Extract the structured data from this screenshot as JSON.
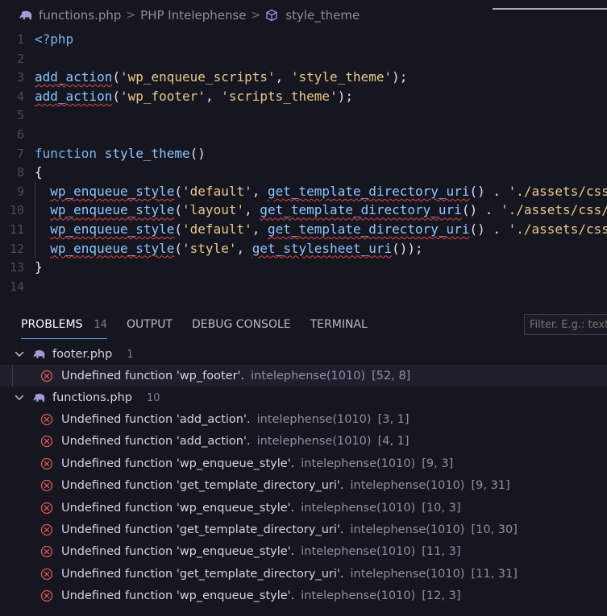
{
  "breadcrumb": {
    "file": "functions.php",
    "section": "PHP Intelephense",
    "symbol": "style_theme"
  },
  "editor": {
    "lines": [
      {
        "n": "1",
        "tokens": [
          {
            "t": "<?php",
            "c": "kw"
          }
        ]
      },
      {
        "n": "2",
        "tokens": []
      },
      {
        "n": "3",
        "tokens": [
          {
            "t": "add_action",
            "c": "fn",
            "sq": true
          },
          {
            "t": "(",
            "c": "punc"
          },
          {
            "t": "'wp_enqueue_scripts'",
            "c": "str"
          },
          {
            "t": ", ",
            "c": "punc"
          },
          {
            "t": "'style_theme'",
            "c": "str"
          },
          {
            "t": ");",
            "c": "punc"
          }
        ]
      },
      {
        "n": "4",
        "tokens": [
          {
            "t": "add_action",
            "c": "fn",
            "sq": true
          },
          {
            "t": "(",
            "c": "punc"
          },
          {
            "t": "'wp_footer'",
            "c": "str"
          },
          {
            "t": ", ",
            "c": "punc"
          },
          {
            "t": "'scripts_theme'",
            "c": "str"
          },
          {
            "t": ");",
            "c": "punc"
          }
        ]
      },
      {
        "n": "5",
        "tokens": []
      },
      {
        "n": "6",
        "tokens": []
      },
      {
        "n": "7",
        "tokens": [
          {
            "t": "function ",
            "c": "kw"
          },
          {
            "t": "style_theme",
            "c": "fn"
          },
          {
            "t": "()",
            "c": "punc"
          }
        ]
      },
      {
        "n": "8",
        "tokens": [
          {
            "t": "{",
            "c": "brace"
          }
        ]
      },
      {
        "n": "9",
        "tokens": [
          {
            "t": "  ",
            "c": "plain"
          },
          {
            "t": "wp_enqueue_style",
            "c": "fn",
            "sq": true
          },
          {
            "t": "(",
            "c": "punc"
          },
          {
            "t": "'default'",
            "c": "str"
          },
          {
            "t": ", ",
            "c": "punc"
          },
          {
            "t": "get_template_directory_uri",
            "c": "fn",
            "sq": true
          },
          {
            "t": "() . ",
            "c": "punc"
          },
          {
            "t": "'./assets/css",
            "c": "str"
          }
        ]
      },
      {
        "n": "10",
        "tokens": [
          {
            "t": "  ",
            "c": "plain"
          },
          {
            "t": "wp_enqueue_style",
            "c": "fn",
            "sq": true
          },
          {
            "t": "(",
            "c": "punc"
          },
          {
            "t": "'layout'",
            "c": "str"
          },
          {
            "t": ", ",
            "c": "punc"
          },
          {
            "t": "get_template_directory_uri",
            "c": "fn",
            "sq": true
          },
          {
            "t": "() . ",
            "c": "punc"
          },
          {
            "t": "'./assets/css/",
            "c": "str"
          }
        ]
      },
      {
        "n": "11",
        "tokens": [
          {
            "t": "  ",
            "c": "plain"
          },
          {
            "t": "wp_enqueue_style",
            "c": "fn",
            "sq": true
          },
          {
            "t": "(",
            "c": "punc"
          },
          {
            "t": "'default'",
            "c": "str"
          },
          {
            "t": ", ",
            "c": "punc"
          },
          {
            "t": "get_template_directory_uri",
            "c": "fn",
            "sq": true
          },
          {
            "t": "() . ",
            "c": "punc"
          },
          {
            "t": "'./assets/css",
            "c": "str"
          }
        ]
      },
      {
        "n": "12",
        "tokens": [
          {
            "t": "  ",
            "c": "plain"
          },
          {
            "t": "wp_enqueue_style",
            "c": "fn",
            "sq": true
          },
          {
            "t": "(",
            "c": "punc"
          },
          {
            "t": "'style'",
            "c": "str"
          },
          {
            "t": ", ",
            "c": "punc"
          },
          {
            "t": "get_stylesheet_uri",
            "c": "fn",
            "sq": true
          },
          {
            "t": "());",
            "c": "punc"
          }
        ]
      },
      {
        "n": "13",
        "tokens": [
          {
            "t": "}",
            "c": "brace"
          }
        ]
      },
      {
        "n": "14",
        "tokens": []
      }
    ]
  },
  "panel": {
    "tabs": [
      {
        "label": "PROBLEMS",
        "badge": "14",
        "active": true
      },
      {
        "label": "OUTPUT"
      },
      {
        "label": "DEBUG CONSOLE"
      },
      {
        "label": "TERMINAL"
      }
    ],
    "filter_placeholder": "Filter. E.g.: text"
  },
  "problems": {
    "groups": [
      {
        "file": "footer.php",
        "count": "1",
        "items": [
          {
            "msg": "Undefined function 'wp_footer'.",
            "src": "intelephense(1010)",
            "pos": "[52, 8]"
          }
        ]
      },
      {
        "file": "functions.php",
        "count": "10",
        "items": [
          {
            "msg": "Undefined function 'add_action'.",
            "src": "intelephense(1010)",
            "pos": "[3, 1]"
          },
          {
            "msg": "Undefined function 'add_action'.",
            "src": "intelephense(1010)",
            "pos": "[4, 1]"
          },
          {
            "msg": "Undefined function 'wp_enqueue_style'.",
            "src": "intelephense(1010)",
            "pos": "[9, 3]"
          },
          {
            "msg": "Undefined function 'get_template_directory_uri'.",
            "src": "intelephense(1010)",
            "pos": "[9, 31]"
          },
          {
            "msg": "Undefined function 'wp_enqueue_style'.",
            "src": "intelephense(1010)",
            "pos": "[10, 3]"
          },
          {
            "msg": "Undefined function 'get_template_directory_uri'.",
            "src": "intelephense(1010)",
            "pos": "[10, 30]"
          },
          {
            "msg": "Undefined function 'wp_enqueue_style'.",
            "src": "intelephense(1010)",
            "pos": "[11, 3]"
          },
          {
            "msg": "Undefined function 'get_template_directory_uri'.",
            "src": "intelephense(1010)",
            "pos": "[11, 31]"
          },
          {
            "msg": "Undefined function 'wp_enqueue_style'.",
            "src": "intelephense(1010)",
            "pos": "[12, 3]"
          }
        ]
      }
    ]
  },
  "icons": {
    "file_icon": "php-elephant-icon",
    "symbol_icon": "cube-icon",
    "error_icon": "error-circle-icon",
    "chevron_icon": "chevron-down-icon"
  },
  "colors": {
    "background": "#15161f",
    "error": "#e04a4a",
    "string": "#e9c88a",
    "function": "#8fc5ff",
    "php_icon": "#a99ad6"
  }
}
